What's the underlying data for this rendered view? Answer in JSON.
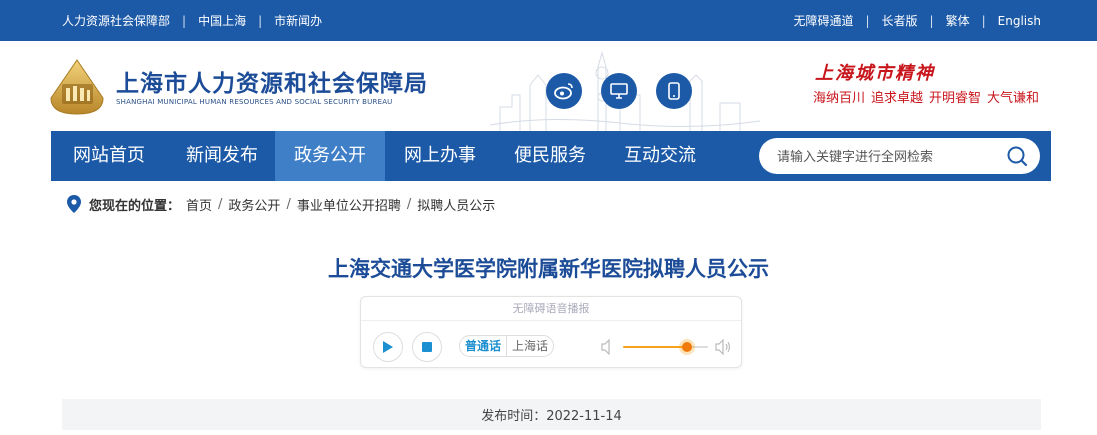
{
  "topbar": {
    "left_links": [
      "人力资源社会保障部",
      "中国上海",
      "市新闻办"
    ],
    "right_links": [
      "无障碍通道",
      "长者版",
      "繁体",
      "English"
    ],
    "separator": "|"
  },
  "header": {
    "title_cn": "上海市人力资源和社会保障局",
    "title_en": "SHANGHAI MUNICIPAL HUMAN RESOURCES AND SOCIAL SECURITY BUREAU",
    "social_icons": [
      "weibo-icon",
      "desktop-icon",
      "mobile-icon"
    ],
    "spirit_title": "上海城市精神",
    "spirit_words": [
      "海纳百川",
      "追求卓越",
      "开明睿智",
      "大气谦和"
    ]
  },
  "nav": {
    "items": [
      "网站首页",
      "新闻发布",
      "政务公开",
      "网上办事",
      "便民服务",
      "互动交流"
    ],
    "active_index": 2,
    "search_placeholder": "请输入关键字进行全网检索"
  },
  "breadcrumb": {
    "label": "您现在的位置：",
    "items": [
      "首页",
      "政务公开",
      "事业单位公开招聘",
      "拟聘人员公示"
    ],
    "separator": "/"
  },
  "article": {
    "title": "上海交通大学医学院附属新华医院拟聘人员公示",
    "publish_text": "发布时间：2022-11-14"
  },
  "player": {
    "header": "无障碍语音播报",
    "lang_options": [
      "普通话",
      "上海话"
    ],
    "selected_lang": "普通话",
    "volume_fraction": 0.75
  },
  "colors": {
    "brand_blue": "#1c5aa8",
    "nav_active": "#3f7fc8",
    "title_blue": "#1c4c98",
    "spirit_red": "#c8161d",
    "volume_orange": "#f7a21b"
  }
}
